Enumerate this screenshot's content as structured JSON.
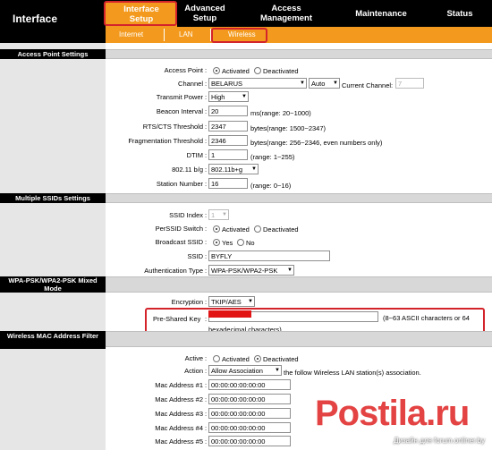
{
  "app": {
    "title": "Interface"
  },
  "topnav": [
    {
      "line1": "Interface",
      "line2": "Setup"
    },
    {
      "line1": "Advanced",
      "line2": "Setup"
    },
    {
      "line1": "Access",
      "line2": "Management"
    },
    {
      "line1": "Maintenance",
      "line2": ""
    },
    {
      "line1": "Status",
      "line2": ""
    }
  ],
  "subnav": [
    "Internet",
    "LAN",
    "Wireless"
  ],
  "sections": {
    "ap": "Access Point Settings",
    "ssid": "Multiple SSIDs Settings",
    "wpa": "WPA-PSK/WPA2-PSK Mixed Mode",
    "mac": "Wireless MAC Address Filter"
  },
  "ap": {
    "access_point": {
      "label": "Access Point",
      "activated": "Activated",
      "deactivated": "Deactivated",
      "selected": "Activated"
    },
    "channel": {
      "label": "Channel",
      "value": "BELARUS",
      "auto": "Auto",
      "current_label": "Current Channel:",
      "current_value": "7"
    },
    "transmit_power": {
      "label": "Transmit Power",
      "value": "High"
    },
    "beacon": {
      "label": "Beacon Interval",
      "value": "20",
      "hint": "ms(range: 20~1000)"
    },
    "rts": {
      "label": "RTS/CTS Threshold",
      "value": "2347",
      "hint": "bytes(range: 1500~2347)"
    },
    "frag": {
      "label": "Fragmentation Threshold",
      "value": "2346",
      "hint": "bytes(range: 256~2346, even numbers only)"
    },
    "dtim": {
      "label": "DTIM",
      "value": "1",
      "hint": "(range: 1~255)"
    },
    "mode": {
      "label": "802.11 b/g",
      "value": "802.11b+g"
    },
    "station": {
      "label": "Station Number",
      "value": "16",
      "hint": "(range: 0~16)"
    }
  },
  "ssid": {
    "index": {
      "label": "SSID Index",
      "value": "1"
    },
    "perssid": {
      "label": "PerSSID Switch",
      "activated": "Activated",
      "deactivated": "Deactivated"
    },
    "broadcast": {
      "label": "Broadcast SSID",
      "yes": "Yes",
      "no": "No"
    },
    "name": {
      "label": "SSID",
      "value": "BYFLY"
    },
    "auth": {
      "label": "Authentication Type",
      "value": "WPA-PSK/WPA2-PSK"
    }
  },
  "wpa": {
    "encryption": {
      "label": "Encryption",
      "value": "TKIP/AES"
    },
    "psk": {
      "label": "Pre-Shared Key",
      "hint1": "(8~63 ASCII characters or 64",
      "hint2": "hexadecimal characters)"
    }
  },
  "mac": {
    "active": {
      "label": "Active",
      "activated": "Activated",
      "deactivated": "Deactivated"
    },
    "action": {
      "label": "Action",
      "value": "Allow Association",
      "suffix": "the follow Wireless LAN station(s) association."
    },
    "addresses": [
      {
        "label": "Mac Address #1",
        "value": "00:00:00:00:00:00"
      },
      {
        "label": "Mac Address #2",
        "value": "00:00:00:00:00:00"
      },
      {
        "label": "Mac Address #3",
        "value": "00:00:00:00:00:00"
      },
      {
        "label": "Mac Address #4",
        "value": "00:00:00:00:00:00"
      },
      {
        "label": "Mac Address #5",
        "value": "00:00:00:00:00:00"
      }
    ]
  },
  "watermark": {
    "word": "Postila.ru",
    "caption": "Дизайн для forum.onliner.by"
  },
  "colors": {
    "accent": "#f39a1e",
    "highlight": "#d4242b",
    "nav_bg": "#000000"
  }
}
